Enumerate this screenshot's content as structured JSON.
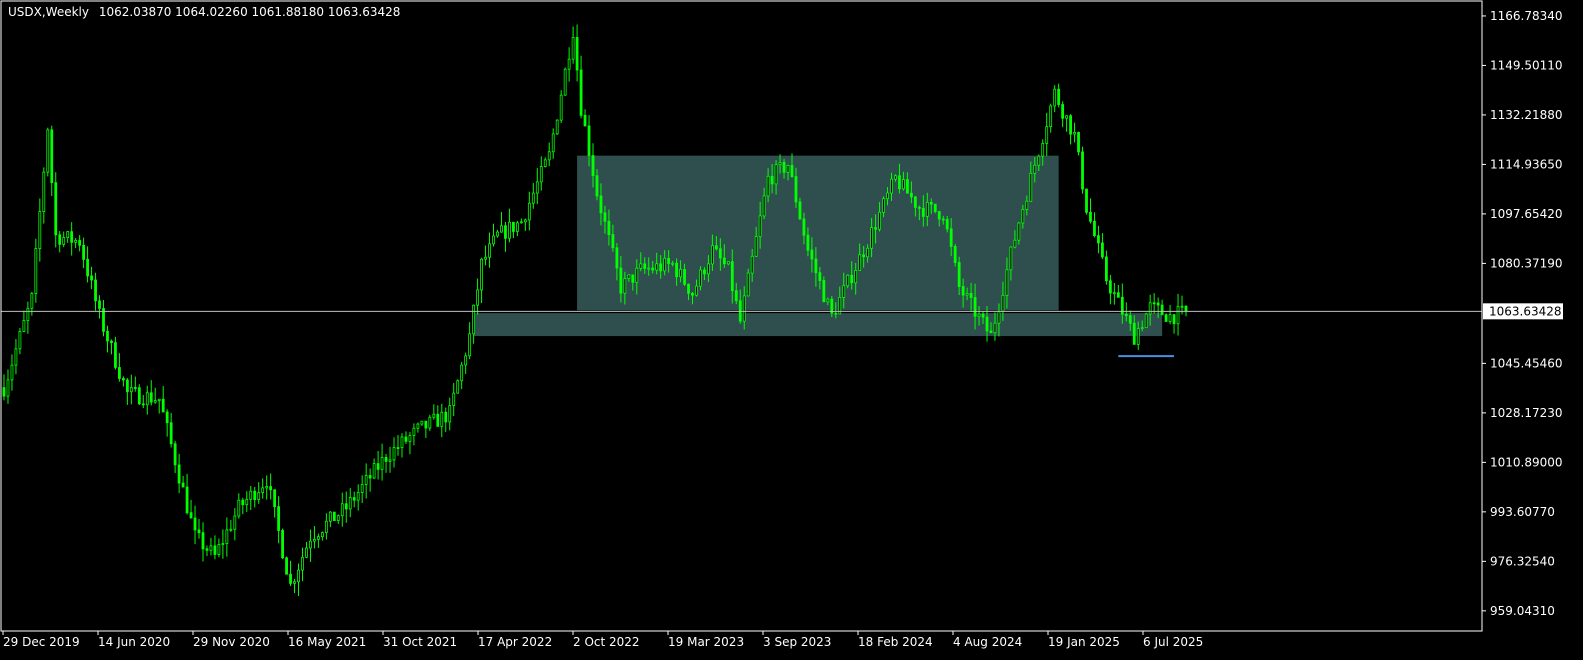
{
  "header": {
    "symbol_timeframe": "USDX,Weekly",
    "ohlc": "1062.03870 1064.02260 1061.88180 1063.63428"
  },
  "colors": {
    "background": "#000000",
    "candle": "#00ff00",
    "axis": "#ffffff",
    "zone": "#2f4f4f",
    "price_line": "#c0c0c0",
    "support_line": "#4a90e2"
  },
  "chart_data": {
    "type": "candlestick",
    "symbol": "USDX",
    "timeframe": "Weekly",
    "current_price": "1063.63428",
    "y_ticks": [
      "1166.78340",
      "1149.50110",
      "1132.21880",
      "1114.93650",
      "1097.65420",
      "1080.37190",
      "1045.45460",
      "1028.17230",
      "1010.89000",
      "993.60770",
      "976.32540",
      "959.04310"
    ],
    "x_ticks": [
      "29 Dec 2019",
      "14 Jun 2020",
      "29 Nov 2020",
      "16 May 2021",
      "31 Oct 2021",
      "17 Apr 2022",
      "2 Oct 2022",
      "19 Mar 2023",
      "3 Sep 2023",
      "18 Feb 2024",
      "4 Aug 2024",
      "19 Jan 2025",
      "6 Jul 2025"
    ],
    "y_range": [
      952,
      1172
    ],
    "grid": false,
    "price_path": [
      [
        "2019-12-29",
        1037
      ],
      [
        "2020-02-16",
        1068
      ],
      [
        "2020-03-15",
        1128
      ],
      [
        "2020-03-29",
        1090
      ],
      [
        "2020-05-10",
        1088
      ],
      [
        "2020-06-14",
        1062
      ],
      [
        "2020-08-02",
        1035
      ],
      [
        "2020-09-27",
        1033
      ],
      [
        "2020-11-29",
        985
      ],
      [
        "2021-01-03",
        978
      ],
      [
        "2021-02-14",
        995
      ],
      [
        "2021-04-04",
        1005
      ],
      [
        "2021-05-16",
        968
      ],
      [
        "2021-06-20",
        985
      ],
      [
        "2021-08-22",
        995
      ],
      [
        "2021-10-31",
        1013
      ],
      [
        "2021-12-26",
        1022
      ],
      [
        "2022-02-20",
        1028
      ],
      [
        "2022-03-27",
        1055
      ],
      [
        "2022-04-17",
        1080
      ],
      [
        "2022-05-15",
        1090
      ],
      [
        "2022-06-26",
        1095
      ],
      [
        "2022-08-14",
        1118
      ],
      [
        "2022-09-25",
        1162
      ],
      [
        "2022-10-09",
        1135
      ],
      [
        "2022-11-06",
        1105
      ],
      [
        "2022-12-18",
        1072
      ],
      [
        "2023-01-22",
        1078
      ],
      [
        "2023-03-19",
        1080
      ],
      [
        "2023-04-23",
        1070
      ],
      [
        "2023-05-28",
        1085
      ],
      [
        "2023-06-25",
        1078
      ],
      [
        "2023-07-16",
        1060
      ],
      [
        "2023-09-03",
        1110
      ],
      [
        "2023-10-08",
        1115
      ],
      [
        "2023-11-12",
        1085
      ],
      [
        "2023-12-24",
        1062
      ],
      [
        "2024-02-18",
        1085
      ],
      [
        "2024-04-14",
        1110
      ],
      [
        "2024-05-26",
        1100
      ],
      [
        "2024-07-07",
        1098
      ],
      [
        "2024-08-04",
        1072
      ],
      [
        "2024-09-29",
        1055
      ],
      [
        "2024-11-17",
        1095
      ],
      [
        "2025-01-19",
        1140
      ],
      [
        "2025-02-23",
        1125
      ],
      [
        "2025-03-16",
        1100
      ],
      [
        "2025-04-20",
        1075
      ],
      [
        "2025-06-08",
        1055
      ],
      [
        "2025-07-06",
        1065
      ],
      [
        "2025-08-10",
        1062
      ],
      [
        "2025-09-07",
        1063
      ]
    ],
    "annotations": [
      {
        "type": "zone",
        "name": "range-box",
        "start": "2022-10-02",
        "end": "2025-01-26",
        "top": 1118,
        "bottom": 1064
      },
      {
        "type": "zone",
        "name": "support-zone",
        "start": "2022-04-03",
        "end": "2025-07-27",
        "top": 1063,
        "bottom": 1055
      },
      {
        "type": "line",
        "name": "support-low",
        "start": "2025-05-11",
        "end": "2025-08-17",
        "value": 1048
      },
      {
        "type": "line",
        "name": "current-price",
        "value": 1063.63428
      }
    ]
  }
}
